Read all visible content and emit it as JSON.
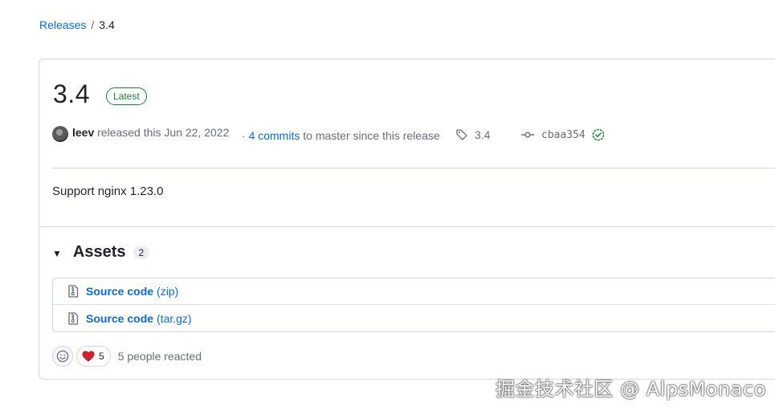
{
  "breadcrumb": {
    "root": "Releases",
    "separator": "/",
    "current": "3.4"
  },
  "release": {
    "title": "3.4",
    "badge": "Latest",
    "author": "leev",
    "released_text": "released this Jun 22, 2022",
    "commits_prefix": "·",
    "commits_link": "4 commits",
    "commits_suffix": "to master since this release",
    "tag": "3.4",
    "commit_hash": "cbaa354",
    "body": "Support nginx 1.23.0"
  },
  "assets": {
    "title": "Assets",
    "count": "2",
    "items": [
      {
        "name": "Source code",
        "ext": "(zip)"
      },
      {
        "name": "Source code",
        "ext": "(tar.gz)"
      }
    ]
  },
  "reactions": {
    "heart_count": "5",
    "summary": "5 people reacted"
  },
  "watermark": "掘金技术社区 @ AlpsMonaco",
  "colors": {
    "link": "#0969da",
    "latest_badge": "#1a7f37",
    "border": "#d0d7de",
    "heart": "#cf222e"
  }
}
